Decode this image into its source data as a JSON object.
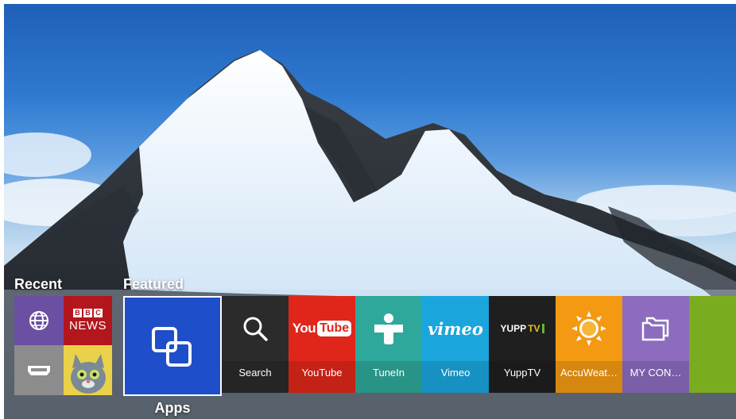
{
  "sections": {
    "recent": "Recent",
    "featured": "Featured"
  },
  "recent_items": [
    {
      "name": "Web Browser",
      "icon": "globe-icon",
      "color": "#6a4fa3"
    },
    {
      "name": "BBC News",
      "icon": "bbc-news-logo",
      "color": "#b3161c",
      "logo_top": "BBC",
      "logo_bottom": "NEWS"
    },
    {
      "name": "HDMI",
      "icon": "hdmi-icon",
      "color": "#8c8c8c"
    },
    {
      "name": "Talking Tom",
      "icon": "cat-avatar-icon",
      "color": "#e9d24a"
    }
  ],
  "apps_tile": {
    "label": "Apps",
    "icon": "apps-icon",
    "color": "#1e4ec9"
  },
  "featured_tiles": [
    {
      "label": "Search",
      "icon": "search-icon",
      "color": "#2b2b2b"
    },
    {
      "label": "YouTube",
      "icon": "youtube-logo",
      "color": "#e0261b",
      "logo_text_1": "You",
      "logo_text_2": "Tube"
    },
    {
      "label": "TuneIn",
      "icon": "tunein-logo",
      "color": "#2ea89a"
    },
    {
      "label": "Vimeo",
      "icon": "vimeo-logo",
      "color": "#1aa6dd",
      "logo_text": "vimeo"
    },
    {
      "label": "YuppTV",
      "icon": "yupptv-logo",
      "color": "#1f1f1f",
      "logo_text_1": "YUPP",
      "logo_text_2": "TV"
    },
    {
      "label": "AccuWeat…",
      "icon": "sun-icon",
      "color": "#f39a12"
    },
    {
      "label": "MY CON…",
      "icon": "folders-icon",
      "color": "#8d6cc0"
    },
    {
      "label": "",
      "icon": "",
      "color": "#7aac20"
    }
  ]
}
